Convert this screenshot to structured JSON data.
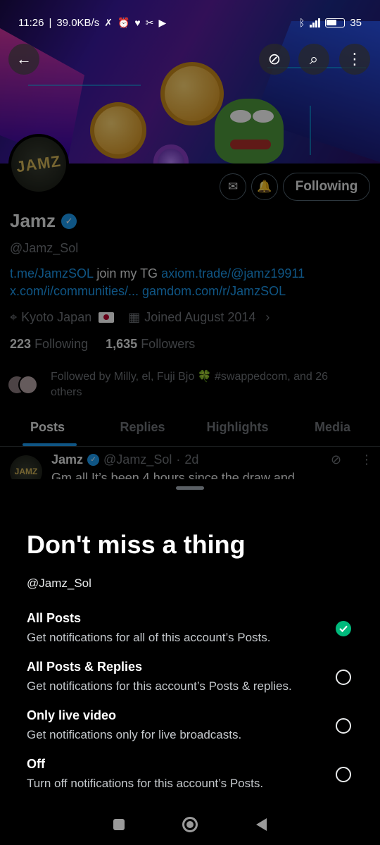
{
  "status_bar": {
    "time": "11:26",
    "speed": "39.0KB/s",
    "battery": "35"
  },
  "profile": {
    "banner_alt": "",
    "avatar_text": "JAMZ",
    "name": "Jamz",
    "handle": "@Jamz_Sol",
    "bio": {
      "link1": "t.me/JamzSOL",
      "text1": " join my TG ",
      "link2": "axiom.trade/@jamz19911",
      "link3": " x.com/i/communities/...",
      "link4": " gamdom.com/r/JamzSOL"
    },
    "location": "Kyoto Japan",
    "joined": "Joined August 2014",
    "following_count": "223",
    "following_label": "Following",
    "followers_count": "1,635",
    "followers_label": "Followers",
    "followed_by": "Followed by Milly, el, Fuji Bjo 🍀 #swappedcom, and 26 others",
    "follow_button": "Following"
  },
  "tabs": [
    {
      "label": "Posts",
      "active": true
    },
    {
      "label": "Replies",
      "active": false
    },
    {
      "label": "Highlights",
      "active": false
    },
    {
      "label": "Media",
      "active": false
    }
  ],
  "post": {
    "author": "Jamz",
    "handle": "@Jamz_Sol",
    "time": "2d",
    "text": "Gm all It’s been 4 hours since the draw and"
  },
  "sheet": {
    "title": "Don't miss a thing",
    "handle": "@Jamz_Sol",
    "options": [
      {
        "title": "All Posts",
        "desc": "Get notifications for all of this account’s Posts.",
        "selected": true
      },
      {
        "title": "All Posts & Replies",
        "desc": "Get notifications for this account’s Posts & replies.",
        "selected": false
      },
      {
        "title": "Only live video",
        "desc": "Get notifications only for live broadcasts.",
        "selected": false
      },
      {
        "title": "Off",
        "desc": "Turn off notifications for this account’s Posts.",
        "selected": false
      }
    ]
  },
  "colors": {
    "accent": "#1d9bf0",
    "selected": "#00ba7c",
    "background": "#000000"
  }
}
